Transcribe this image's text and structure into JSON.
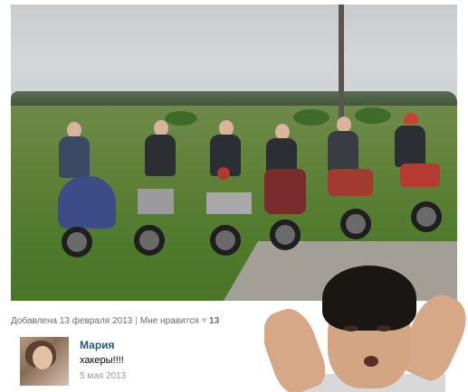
{
  "post": {
    "added_label": "Добавлена 13 февраля 2013",
    "like_label": "Мне нравится",
    "like_count": "13"
  },
  "comment": {
    "author": "Мария",
    "text": "хакеры!!!!",
    "date": "5 мая 2013"
  },
  "icons": {
    "like": "heart-icon"
  },
  "colors": {
    "author": "#2b587a",
    "meta": "#6b6b6b",
    "date": "#999999"
  }
}
